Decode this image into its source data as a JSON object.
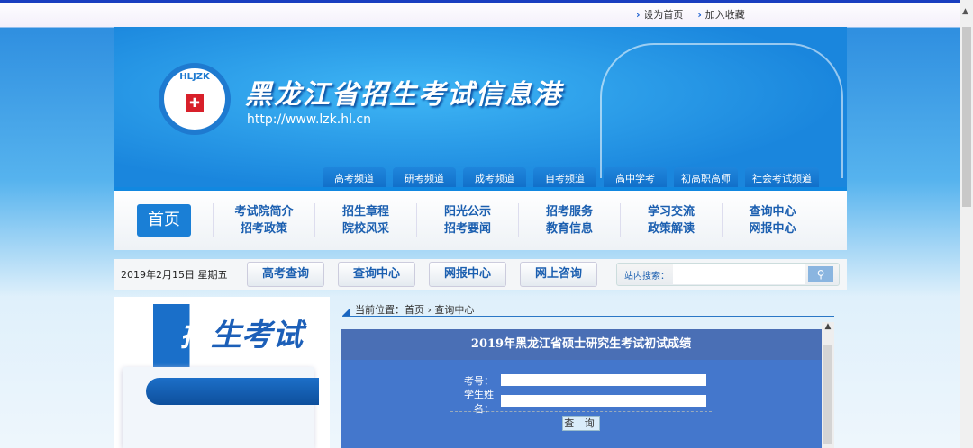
{
  "top_links": [
    "设为首页",
    "加入收藏"
  ],
  "header": {
    "logo_text": "HLJZK",
    "title": "黑龙江省招生考试信息港",
    "url": "http://www.lzk.hl.cn"
  },
  "channels": [
    "高考频道",
    "研考频道",
    "成考频道",
    "自考频道",
    "高中学考",
    "初高职高师",
    "社会考试频道"
  ],
  "nav": {
    "home": "首页",
    "columns": [
      [
        "考试院简介",
        "招考政策"
      ],
      [
        "招生章程",
        "院校风采"
      ],
      [
        "阳光公示",
        "招考要闻"
      ],
      [
        "招考服务",
        "教育信息"
      ],
      [
        "学习交流",
        "政策解读"
      ],
      [
        "查询中心",
        "网报中心"
      ]
    ]
  },
  "toolbar": {
    "date": "2019年2月15日 星期五",
    "buttons": [
      "高考查询",
      "查询中心",
      "网报中心",
      "网上咨询"
    ],
    "search_label": "站内搜索："
  },
  "left_banner": "招生考试",
  "breadcrumb": {
    "label": "当前位置：",
    "items": [
      "首页",
      "查询中心"
    ]
  },
  "form": {
    "title": "2019年黑龙江省硕士研究生考试初试成绩",
    "exam_no_label": "考号：",
    "name_label": "学生姓名：",
    "submit": "查 询"
  }
}
